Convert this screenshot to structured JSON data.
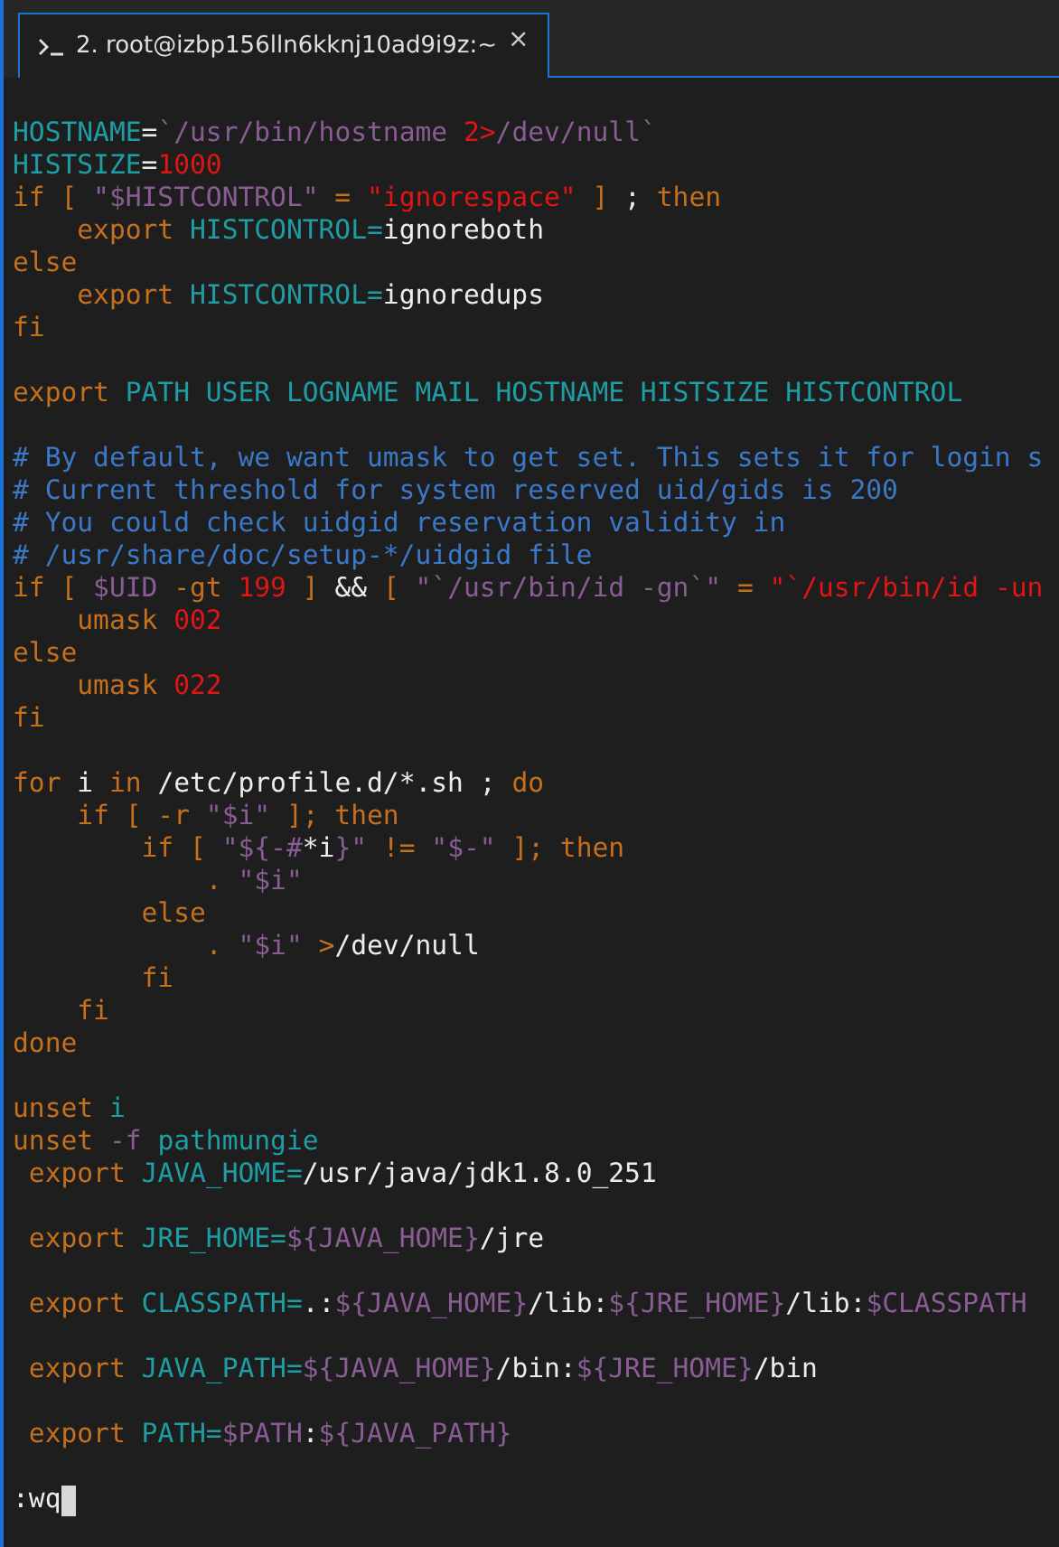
{
  "tabs": [
    {
      "title": "2. root@izbp156lln6kknj10ad9i9z:~",
      "close": "×",
      "selected": true
    }
  ],
  "editor": {
    "lines": [
      {
        "kind": "code",
        "segments": [
          {
            "kind": "ident",
            "text": "HOSTNAME"
          },
          {
            "kind": "plain",
            "text": "="
          },
          {
            "kind": "command",
            "text": "`/usr/bin/hostname "
          },
          {
            "kind": "number",
            "text": "2>"
          },
          {
            "kind": "command",
            "text": "/dev/null`"
          }
        ]
      },
      {
        "kind": "code",
        "segments": [
          {
            "kind": "ident",
            "text": "HISTSIZE"
          },
          {
            "kind": "plain",
            "text": "="
          },
          {
            "kind": "number",
            "text": "1000"
          }
        ]
      },
      {
        "kind": "code",
        "segments": [
          {
            "kind": "keyword",
            "text": "if [ "
          },
          {
            "kind": "command",
            "text": "\"$HISTCONTROL\""
          },
          {
            "kind": "keyword",
            "text": " = "
          },
          {
            "kind": "number",
            "text": "\"ignorespace\""
          },
          {
            "kind": "keyword",
            "text": " ] "
          },
          {
            "kind": "plain",
            "text": "; "
          },
          {
            "kind": "keyword",
            "text": "then"
          }
        ]
      },
      {
        "kind": "code",
        "segments": [
          {
            "kind": "keyword",
            "text": "    export "
          },
          {
            "kind": "ident",
            "text": "HISTCONTROL="
          },
          {
            "kind": "plain",
            "text": "ignoreboth"
          }
        ]
      },
      {
        "kind": "code",
        "segments": [
          {
            "kind": "keyword",
            "text": "else"
          }
        ]
      },
      {
        "kind": "code",
        "segments": [
          {
            "kind": "keyword",
            "text": "    export "
          },
          {
            "kind": "ident",
            "text": "HISTCONTROL="
          },
          {
            "kind": "plain",
            "text": "ignoredups"
          }
        ]
      },
      {
        "kind": "code",
        "segments": [
          {
            "kind": "keyword",
            "text": "fi"
          }
        ]
      },
      {
        "kind": "blank"
      },
      {
        "kind": "code",
        "segments": [
          {
            "kind": "keyword",
            "text": "export "
          },
          {
            "kind": "ident",
            "text": "PATH USER LOGNAME MAIL HOSTNAME HISTSIZE HISTCONTROL"
          }
        ]
      },
      {
        "kind": "blank"
      },
      {
        "kind": "code",
        "segments": [
          {
            "kind": "comment",
            "text": "# By default, we want umask to get set. This sets it for login s"
          }
        ]
      },
      {
        "kind": "code",
        "segments": [
          {
            "kind": "comment",
            "text": "# Current threshold for system reserved uid/gids is 200"
          }
        ]
      },
      {
        "kind": "code",
        "segments": [
          {
            "kind": "comment",
            "text": "# You could check uidgid reservation validity in"
          }
        ]
      },
      {
        "kind": "code",
        "segments": [
          {
            "kind": "comment",
            "text": "# /usr/share/doc/setup-*/uidgid file"
          }
        ]
      },
      {
        "kind": "code",
        "segments": [
          {
            "kind": "keyword",
            "text": "if [ "
          },
          {
            "kind": "command",
            "text": "$UID"
          },
          {
            "kind": "keyword",
            "text": " -gt "
          },
          {
            "kind": "number",
            "text": "199"
          },
          {
            "kind": "keyword",
            "text": " ] "
          },
          {
            "kind": "plain",
            "text": "&& "
          },
          {
            "kind": "keyword",
            "text": "[ "
          },
          {
            "kind": "command",
            "text": "\"`/usr/bin/id -gn`\""
          },
          {
            "kind": "keyword",
            "text": " = "
          },
          {
            "kind": "number",
            "text": "\"`/usr/bin/id -un"
          }
        ]
      },
      {
        "kind": "code",
        "segments": [
          {
            "kind": "keyword",
            "text": "    umask "
          },
          {
            "kind": "number",
            "text": "002"
          }
        ]
      },
      {
        "kind": "code",
        "segments": [
          {
            "kind": "keyword",
            "text": "else"
          }
        ]
      },
      {
        "kind": "code",
        "segments": [
          {
            "kind": "keyword",
            "text": "    umask "
          },
          {
            "kind": "number",
            "text": "022"
          }
        ]
      },
      {
        "kind": "code",
        "segments": [
          {
            "kind": "keyword",
            "text": "fi"
          }
        ]
      },
      {
        "kind": "blank"
      },
      {
        "kind": "code",
        "segments": [
          {
            "kind": "keyword",
            "text": "for "
          },
          {
            "kind": "plain",
            "text": "i "
          },
          {
            "kind": "keyword",
            "text": "in "
          },
          {
            "kind": "plain",
            "text": "/etc/profile.d/*.sh ; "
          },
          {
            "kind": "keyword",
            "text": "do"
          }
        ]
      },
      {
        "kind": "code",
        "segments": [
          {
            "kind": "keyword",
            "text": "    if [ -r "
          },
          {
            "kind": "command",
            "text": "\"$i\""
          },
          {
            "kind": "keyword",
            "text": " ]; then"
          }
        ]
      },
      {
        "kind": "code",
        "segments": [
          {
            "kind": "keyword",
            "text": "        if [ "
          },
          {
            "kind": "command",
            "text": "\"${-#"
          },
          {
            "kind": "plain",
            "text": "*i"
          },
          {
            "kind": "command",
            "text": "}\""
          },
          {
            "kind": "keyword",
            "text": " != "
          },
          {
            "kind": "command",
            "text": "\"$-\""
          },
          {
            "kind": "keyword",
            "text": " ]; then"
          }
        ]
      },
      {
        "kind": "code",
        "segments": [
          {
            "kind": "keyword",
            "text": "            . "
          },
          {
            "kind": "command",
            "text": "\"$i\""
          }
        ]
      },
      {
        "kind": "code",
        "segments": [
          {
            "kind": "keyword",
            "text": "        else"
          }
        ]
      },
      {
        "kind": "code",
        "segments": [
          {
            "kind": "keyword",
            "text": "            . "
          },
          {
            "kind": "command",
            "text": "\"$i\""
          },
          {
            "kind": "keyword",
            "text": " >"
          },
          {
            "kind": "plain",
            "text": "/dev/null"
          }
        ]
      },
      {
        "kind": "code",
        "segments": [
          {
            "kind": "keyword",
            "text": "        fi"
          }
        ]
      },
      {
        "kind": "code",
        "segments": [
          {
            "kind": "keyword",
            "text": "    fi"
          }
        ]
      },
      {
        "kind": "code",
        "segments": [
          {
            "kind": "keyword",
            "text": "done"
          }
        ]
      },
      {
        "kind": "blank"
      },
      {
        "kind": "code",
        "segments": [
          {
            "kind": "keyword",
            "text": "unset "
          },
          {
            "kind": "ident",
            "text": "i"
          }
        ]
      },
      {
        "kind": "code",
        "segments": [
          {
            "kind": "keyword",
            "text": "unset "
          },
          {
            "kind": "command",
            "text": "-f "
          },
          {
            "kind": "ident",
            "text": "pathmungie"
          }
        ]
      },
      {
        "kind": "code",
        "segments": [
          {
            "kind": "keyword",
            "text": " export "
          },
          {
            "kind": "ident",
            "text": "JAVA_HOME="
          },
          {
            "kind": "plain",
            "text": "/usr/java/jdk1.8.0_251"
          }
        ]
      },
      {
        "kind": "blank"
      },
      {
        "kind": "code",
        "segments": [
          {
            "kind": "keyword",
            "text": " export "
          },
          {
            "kind": "ident",
            "text": "JRE_HOME="
          },
          {
            "kind": "command",
            "text": "${JAVA_HOME}"
          },
          {
            "kind": "plain",
            "text": "/jre"
          }
        ]
      },
      {
        "kind": "blank"
      },
      {
        "kind": "code",
        "segments": [
          {
            "kind": "keyword",
            "text": " export "
          },
          {
            "kind": "ident",
            "text": "CLASSPATH="
          },
          {
            "kind": "plain",
            "text": ".:"
          },
          {
            "kind": "command",
            "text": "${JAVA_HOME}"
          },
          {
            "kind": "plain",
            "text": "/lib:"
          },
          {
            "kind": "command",
            "text": "${JRE_HOME}"
          },
          {
            "kind": "plain",
            "text": "/lib:"
          },
          {
            "kind": "command",
            "text": "$CLASSPATH"
          }
        ]
      },
      {
        "kind": "blank"
      },
      {
        "kind": "code",
        "segments": [
          {
            "kind": "keyword",
            "text": " export "
          },
          {
            "kind": "ident",
            "text": "JAVA_PATH="
          },
          {
            "kind": "command",
            "text": "${JAVA_HOME}"
          },
          {
            "kind": "plain",
            "text": "/bin:"
          },
          {
            "kind": "command",
            "text": "${JRE_HOME}"
          },
          {
            "kind": "plain",
            "text": "/bin"
          }
        ]
      },
      {
        "kind": "blank"
      },
      {
        "kind": "code",
        "segments": [
          {
            "kind": "keyword",
            "text": " export "
          },
          {
            "kind": "ident",
            "text": "PATH="
          },
          {
            "kind": "command",
            "text": "$PATH"
          },
          {
            "kind": "plain",
            "text": ":"
          },
          {
            "kind": "command",
            "text": "${JAVA_PATH}"
          }
        ]
      },
      {
        "kind": "blank"
      }
    ]
  },
  "command_line": {
    "text": ":wq"
  }
}
